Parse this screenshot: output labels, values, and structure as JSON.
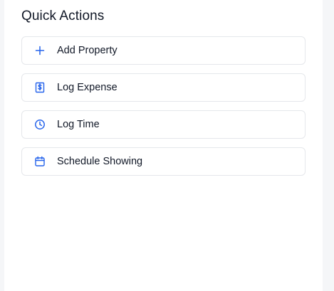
{
  "panel": {
    "title": "Quick Actions",
    "accent_color": "#2563eb",
    "actions": [
      {
        "label": "Add Property",
        "icon": "plus-icon"
      },
      {
        "label": "Log Expense",
        "icon": "receipt-dollar-icon"
      },
      {
        "label": "Log Time",
        "icon": "clock-icon"
      },
      {
        "label": "Schedule Showing",
        "icon": "calendar-icon"
      }
    ]
  }
}
